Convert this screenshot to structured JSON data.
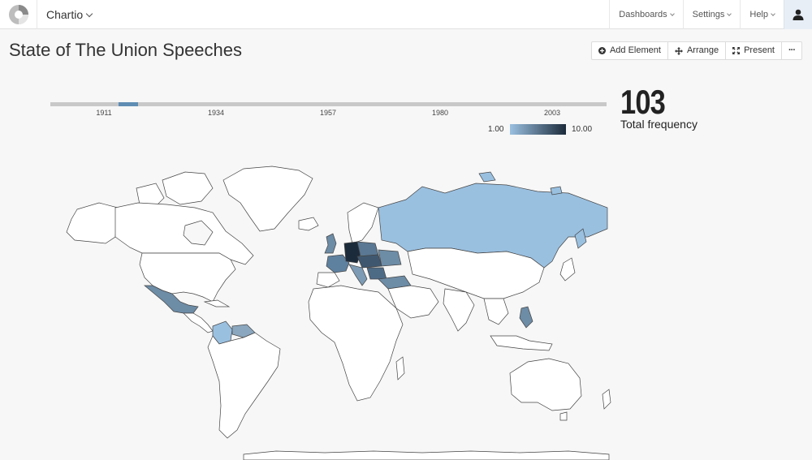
{
  "app": {
    "name": "Chartio"
  },
  "nav": {
    "items": [
      "Dashboards",
      "Settings",
      "Help"
    ]
  },
  "page": {
    "title": "State of The Union Speeches"
  },
  "toolbar": {
    "add_element": "Add Element",
    "arrange": "Arrange",
    "present": "Present",
    "more": "···"
  },
  "timeline": {
    "ticks": [
      "1911",
      "1934",
      "1957",
      "1980",
      "2003"
    ],
    "range_start": 0.123,
    "range_end": 0.158
  },
  "legend": {
    "min": "1.00",
    "max": "10.00",
    "color_low": "#9ac0e0",
    "color_high": "#1c2b3b"
  },
  "metric": {
    "value": "103",
    "label": "Total frequency"
  },
  "colors": {
    "accent": "#5f8db3",
    "country_default": "#ffffff"
  }
}
